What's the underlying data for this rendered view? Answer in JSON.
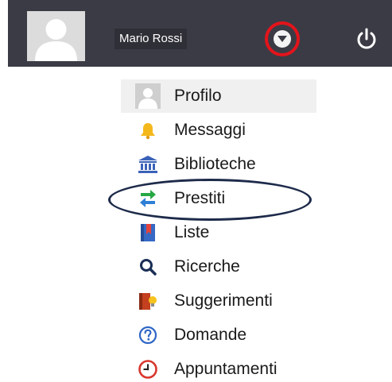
{
  "header": {
    "user_name": "Mario Rossi"
  },
  "icons": {
    "avatar": "user-avatar-icon",
    "dropdown": "caret-down-icon",
    "power": "power-icon"
  },
  "colors": {
    "topbar": "#3b3b45",
    "dropdown_ring": "#e3141b",
    "annotation_ellipse": "#1d2a4a"
  },
  "menu": {
    "items": [
      {
        "label": "Profilo",
        "icon": "user-icon"
      },
      {
        "label": "Messaggi",
        "icon": "bell-icon"
      },
      {
        "label": "Biblioteche",
        "icon": "library-icon"
      },
      {
        "label": "Prestiti",
        "icon": "loan-arrows-icon"
      },
      {
        "label": "Liste",
        "icon": "bookmark-book-icon"
      },
      {
        "label": "Ricerche",
        "icon": "magnifier-icon"
      },
      {
        "label": "Suggerimenti",
        "icon": "suggestion-icon"
      },
      {
        "label": "Domande",
        "icon": "question-icon"
      },
      {
        "label": "Appuntamenti",
        "icon": "clock-icon"
      }
    ]
  }
}
